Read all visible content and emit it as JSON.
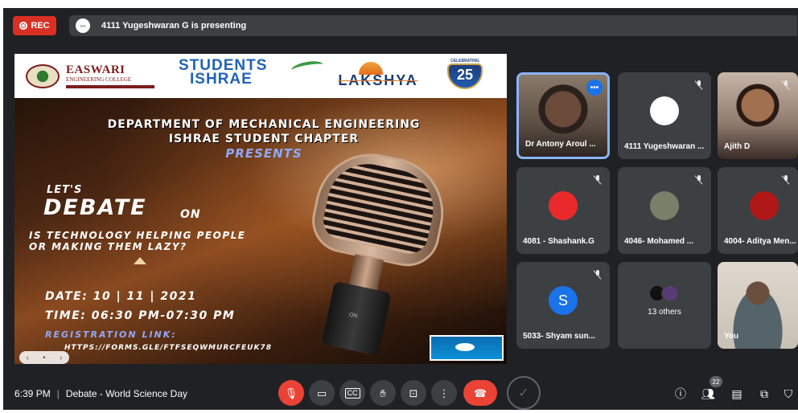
{
  "topbar": {
    "rec_label": "REC",
    "presenting_text": "4111 Yugeshwaran G is presenting"
  },
  "slide": {
    "logos": {
      "easwari_name": "EASWARI",
      "easwari_sub": "ENGINEERING COLLEGE",
      "students_l1": "STUDENTS",
      "students_l2": "ISHRAE",
      "lakshya": "LAKSHYA",
      "anniv_number": "25",
      "anniv_text": "CELEBRATING"
    },
    "dept_line1": "DEPARTMENT OF MECHANICAL ENGINEERING",
    "dept_line2": "ISHRAE STUDENT CHAPTER",
    "presents": "PRESENTS",
    "lets": "LET'S",
    "debate": "DEBATE",
    "debate_on": "ON",
    "topic_line1": "IS TECHNOLOGY HELPING PEOPLE",
    "topic_line2": "OR MAKING THEM LAZY?",
    "date": "DATE: 10 | 11 | 2021",
    "time": "TIME: 06:30 PM-07:30 PM",
    "registration_label": "REGISTRATION LINK:",
    "registration_url": "HTTPS://FORMS.GLE/FTFSEQWMURCFEUK78",
    "mic_switch": "ON"
  },
  "participants": [
    {
      "name": "Dr Antony Aroul ...",
      "type": "video",
      "muted": false,
      "active": true
    },
    {
      "name": "4111 Yugeshwaran ...",
      "type": "avatar",
      "avatar_color": "#ffffff",
      "muted": true,
      "active": false
    },
    {
      "name": "Ajith D",
      "type": "video",
      "muted": true,
      "active": false
    },
    {
      "name": "4081 - Shashank.G",
      "type": "avatar",
      "avatar_color": "#ea2a2a",
      "muted": true,
      "active": false
    },
    {
      "name": "4046- Mohamed ...",
      "type": "avatar",
      "avatar_color": "#7a7f6a",
      "muted": true,
      "active": false
    },
    {
      "name": "4004- Aditya Men...",
      "type": "avatar",
      "avatar_color": "#b01818",
      "muted": true,
      "active": false
    },
    {
      "name": "5033- Shyam sun...",
      "type": "letter",
      "letter": "S",
      "avatar_color": "#1a73e8",
      "muted": true,
      "active": false
    },
    {
      "name": "13 others",
      "type": "others",
      "muted": false,
      "active": false
    },
    {
      "name": "You",
      "type": "video",
      "muted": false,
      "active": false
    }
  ],
  "bottombar": {
    "time": "6:39 PM",
    "meeting_title": "Debate - World Science Day",
    "participants_count": "22"
  },
  "colors": {
    "background": "#202124",
    "tile": "#3c4043",
    "danger": "#ea4335",
    "active_border": "#8ab4f8",
    "rec": "#d93025"
  }
}
